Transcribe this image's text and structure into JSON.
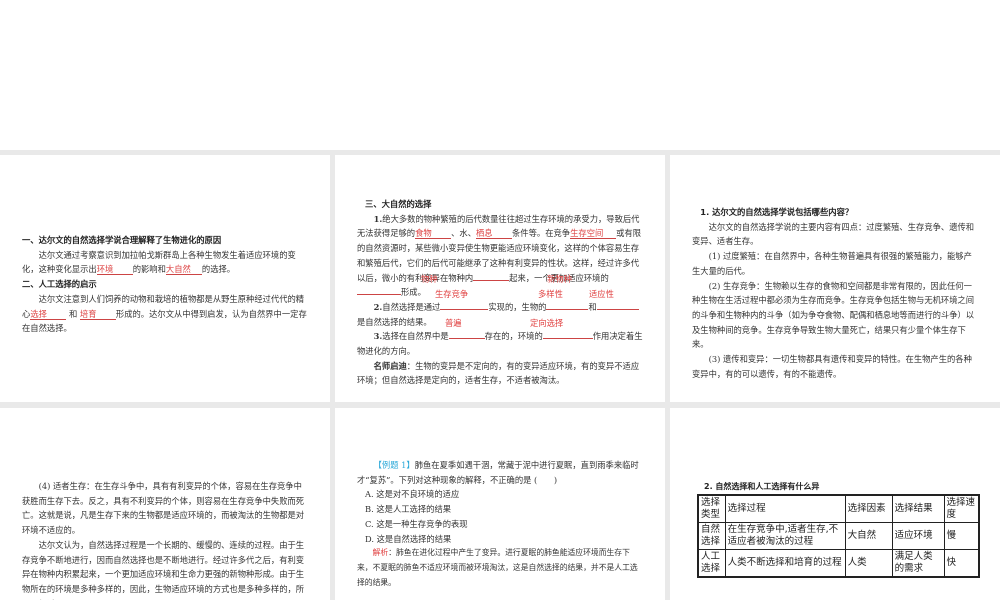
{
  "slide1": {
    "heading1": "一、达尔文的自然选择学说合理解释了生物进化的原因",
    "p1_a": "达尔文通过考察意识到加拉帕戈斯群岛上各种生物发生着适应环境的变化，这种变化显示出",
    "p1_ans1": "环境",
    "p1_b": "的影响和",
    "p1_ans2": "大自然",
    "p1_c": "的选择。",
    "heading2": "二、人工选择的启示",
    "p2_a": "达尔文注意到人们饲养的动物和栽培的植物都是从野生原种经过代代的精心",
    "p2_ans1": "选择",
    "p2_b": "和",
    "p2_ans2": "培育",
    "p2_c": "形成的。达尔文从中得到启发，认为自然界中一定存在自然选择。"
  },
  "slide2": {
    "heading": "三、大自然的选择",
    "q1_num": "1.",
    "q1_a": "绝大多数的物种繁殖的后代数量往往超过生存环境的承受力，导致后代无法获得足够的",
    "q1_ans1": "食物",
    "q1_b": "、水、",
    "q1_ans2": "栖息",
    "q1_c": "条件等。在竞争",
    "q1_ans3": "生存空间",
    "q1_d": "或有限的自然资源时，某些微小变异使生物更能适应环境变化，这样的个体容易生存和繁殖后代，它们的后代可能继承了这种有利变异的性状。这样，经过许多代以后，微小的有利变异在物种内",
    "q1_e": "起来，一个更加适应环境的",
    "q1_f": "形成。",
    "q1_ans_overlay1": "物种",
    "q1_ans_overlay2": "新物种",
    "q2_ans_row1": [
      "生存竞争",
      "多样性",
      "适应性"
    ],
    "q2_num": "2.",
    "q2_a": "自然选择是通过",
    "q2_b": "实现的，生物的",
    "q2_c": "和",
    "q2_d": "是自然选择的结果。",
    "q3_ans_row": [
      "普遍",
      "定向选择"
    ],
    "q3_num": "3.",
    "q3_a": "选择在自然界中是",
    "q3_b": "存在的，环境的",
    "q3_c": "作用决定着生物进化的方向。",
    "tip_label": "名师启迪",
    "tip_text": "：生物的变异是不定向的，有的变异适应环境，有的变异不适应环境；但自然选择是定向的，适者生存，不适者被淘汰。"
  },
  "slide3": {
    "question": "1. 达尔文的自然选择学说包括哪些内容？",
    "intro": "达尔文的自然选择学说的主要内容有四点：过度繁殖、生存竞争、遗传和变异、适者生存。",
    "p1": "(1) 过度繁殖：在自然界中，各种生物普遍具有很强的繁殖能力，能够产生大量的后代。",
    "p2": "(2) 生存竞争：生物赖以生存的食物和空间都是非常有限的，因此任何一种生物在生活过程中都必须为生存而竞争。生存竞争包括生物与无机环境之间的斗争和生物种内的斗争（如为争夺食物、配偶和栖息地等而进行的斗争）以及生物种间的竞争。生存竞争导致生物大量死亡，结果只有少量个体生存下来。",
    "p3": "(3) 遗传和变异：一切生物都具有遗传和变异的特性。在生物产生的各种变异中，有的可以遗传，有的不能遗传。"
  },
  "slide4": {
    "p4": "(4) 适者生存：在生存斗争中，具有有利变异的个体，容易在生存竞争中获胜而生存下去。反之，具有不利变异的个体，则容易在生存竞争中失败而死亡。这就是说，凡是生存下来的生物都是适应环境的，而被淘汰的生物都是对环境不适应的。",
    "p5": "达尔文认为，自然选择过程是一个长期的、缓慢的、连续的过程。由于生存竞争不断地进行，因而自然选择也是不断地进行。经过许多代之后，有利变异在物种内积累起来，一个更加适应环境和生命力更强的新物种形成。由于生物所在的环境是多种多样的，因此，生物适应环境的方式也是多种多样的，所以，经过"
  },
  "slide5": {
    "tag": "【例题 1】",
    "stem": "肺鱼在夏季如遇干涸，常藏于泥中进行夏眠，直到雨季来临时才“复苏”。下列对这种现象的解释，不正确的是 (　　)",
    "options": [
      "A. 这是对不良环境的适应",
      "B. 这是人工选择的结果",
      "C. 这是一种生存竞争的表现",
      "D. 这是自然选择的结果"
    ],
    "analysis_label": "解析",
    "analysis_text": "：肺鱼在进化过程中产生了变异。进行夏眠的肺鱼能适应环境而生存下来，不夏眠的肺鱼不适应环境而被环境淘汰，这是自然选择的结果，并不是人工选择的结果。"
  },
  "slide6": {
    "question": "2. 自然选择和人工选择有什么异",
    "table": {
      "headers": [
        "选择类型",
        "选择过程",
        "选择因素",
        "选择结果",
        "选择速度"
      ],
      "rows": [
        [
          "自然选择",
          "在生存竞争中,适者生存,不适应者被淘汰的过程",
          "大自然",
          "适应环境",
          "慢"
        ],
        [
          "人工选择",
          "人类不断选择和培育的过程",
          "人类",
          "满足人类的需求",
          "快"
        ]
      ]
    }
  }
}
